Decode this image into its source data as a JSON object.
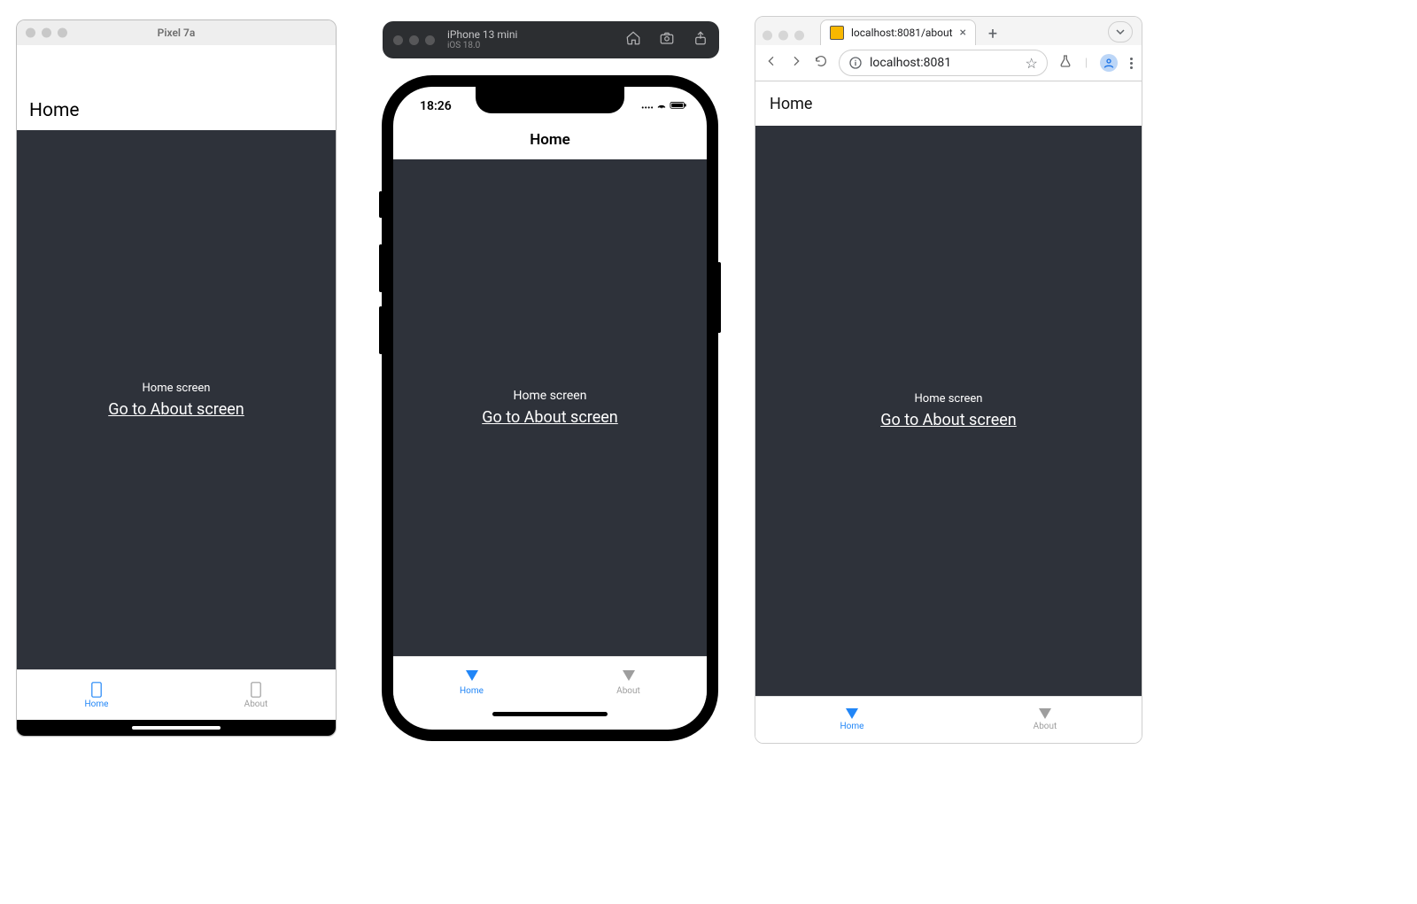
{
  "android": {
    "window_title": "Pixel 7a",
    "header_title": "Home",
    "body_subtitle": "Home screen",
    "body_link": "Go to About screen",
    "tabs": {
      "home": "Home",
      "about": "About"
    }
  },
  "ios": {
    "toolbar": {
      "device": "iPhone 13 mini",
      "os": "iOS 18.0"
    },
    "status_time": "18:26",
    "header_title": "Home",
    "body_subtitle": "Home screen",
    "body_link": "Go to About screen",
    "tabs": {
      "home": "Home",
      "about": "About"
    }
  },
  "chrome": {
    "tab_title": "localhost:8081/about",
    "omnibox_url": "localhost:8081",
    "header_title": "Home",
    "body_subtitle": "Home screen",
    "body_link": "Go to About screen",
    "tabs": {
      "home": "Home",
      "about": "About"
    }
  },
  "colors": {
    "app_background": "#2e323a",
    "accent": "#2186f7",
    "muted": "#9e9e9e"
  }
}
